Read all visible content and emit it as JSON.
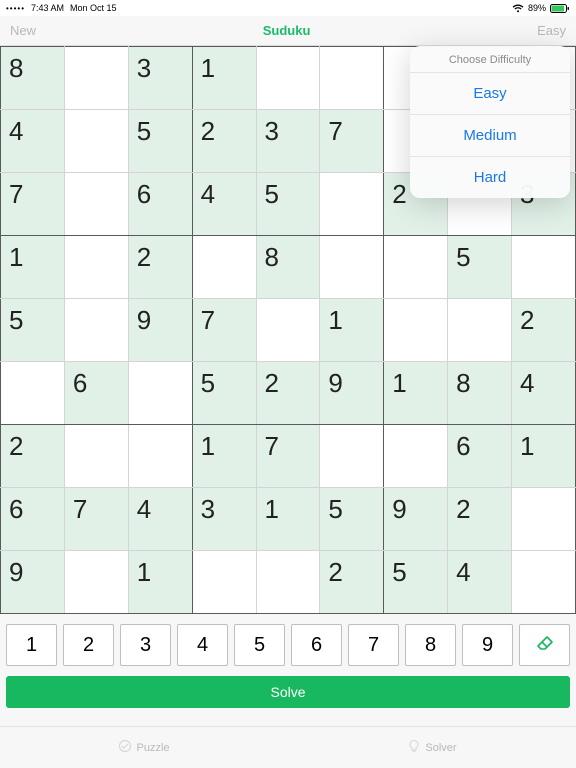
{
  "status": {
    "time": "7:43 AM",
    "date": "Mon Oct 15",
    "battery": "89%"
  },
  "nav": {
    "left": "New",
    "title": "Suduku",
    "right": "Easy"
  },
  "popover": {
    "header": "Choose Difficulty",
    "items": [
      "Easy",
      "Medium",
      "Hard"
    ]
  },
  "board": [
    [
      "8",
      "",
      "",
      "3",
      "",
      "1",
      "",
      "",
      "",
      ""
    ],
    [
      "4",
      "",
      "",
      "5",
      "",
      "2",
      "",
      "3",
      "",
      "7"
    ],
    [
      "7",
      "",
      "",
      "6",
      "",
      "4",
      "",
      "5",
      "",
      ""
    ],
    [
      "1",
      "",
      "",
      "2",
      "",
      "",
      "",
      "8",
      "",
      ""
    ],
    [
      "5",
      "",
      "",
      "9",
      "",
      "7",
      "",
      "",
      "",
      "1"
    ],
    [
      "",
      "",
      "6",
      "",
      "",
      "5",
      "",
      "2",
      "",
      "9"
    ],
    [
      "2",
      "",
      "",
      "",
      "",
      "1",
      "",
      "7",
      "",
      ""
    ],
    [
      "6",
      "",
      "7",
      "4",
      "",
      "3",
      "",
      "1",
      "",
      "5"
    ],
    [
      "9",
      "",
      "",
      "1",
      "",
      "",
      "",
      "",
      "",
      "2"
    ]
  ],
  "grid": [
    {
      "cells": [
        {
          "v": "8",
          "g": true
        },
        {
          "v": "",
          "g": false
        },
        {
          "v": "3",
          "g": true
        },
        {
          "v": "1",
          "g": true
        },
        {
          "v": "",
          "g": false
        },
        {
          "v": "",
          "g": false
        },
        {
          "v": "",
          "g": false
        },
        {
          "v": "",
          "g": false
        },
        {
          "v": "",
          "g": false
        }
      ]
    },
    {
      "cells": [
        {
          "v": "4",
          "g": true
        },
        {
          "v": "",
          "g": false
        },
        {
          "v": "5",
          "g": true
        },
        {
          "v": "2",
          "g": true
        },
        {
          "v": "3",
          "g": true
        },
        {
          "v": "7",
          "g": true
        },
        {
          "v": "",
          "g": false
        },
        {
          "v": "",
          "g": false
        },
        {
          "v": "",
          "g": false
        }
      ]
    },
    {
      "cells": [
        {
          "v": "7",
          "g": true
        },
        {
          "v": "",
          "g": false
        },
        {
          "v": "6",
          "g": true
        },
        {
          "v": "4",
          "g": true
        },
        {
          "v": "5",
          "g": true
        },
        {
          "v": "",
          "g": false
        },
        {
          "v": "2",
          "g": true
        },
        {
          "v": "",
          "g": false
        },
        {
          "v": "3",
          "g": true
        }
      ]
    },
    {
      "cells": [
        {
          "v": "1",
          "g": true
        },
        {
          "v": "",
          "g": false
        },
        {
          "v": "2",
          "g": true
        },
        {
          "v": "",
          "g": false
        },
        {
          "v": "8",
          "g": true
        },
        {
          "v": "",
          "g": false
        },
        {
          "v": "",
          "g": false
        },
        {
          "v": "5",
          "g": true
        },
        {
          "v": "",
          "g": false
        }
      ]
    },
    {
      "cells": [
        {
          "v": "5",
          "g": true
        },
        {
          "v": "",
          "g": false
        },
        {
          "v": "9",
          "g": true
        },
        {
          "v": "7",
          "g": true
        },
        {
          "v": "",
          "g": false
        },
        {
          "v": "1",
          "g": true
        },
        {
          "v": "",
          "g": false
        },
        {
          "v": "",
          "g": false
        },
        {
          "v": "2",
          "g": true
        }
      ]
    },
    {
      "cells": [
        {
          "v": "",
          "g": false
        },
        {
          "v": "6",
          "g": true
        },
        {
          "v": "",
          "g": false
        },
        {
          "v": "5",
          "g": true
        },
        {
          "v": "2",
          "g": true
        },
        {
          "v": "9",
          "g": true
        },
        {
          "v": "1",
          "g": true
        },
        {
          "v": "8",
          "g": true
        },
        {
          "v": "4",
          "g": true
        }
      ]
    },
    {
      "cells": [
        {
          "v": "2",
          "g": true
        },
        {
          "v": "",
          "g": false
        },
        {
          "v": "",
          "g": false
        },
        {
          "v": "1",
          "g": true
        },
        {
          "v": "7",
          "g": true
        },
        {
          "v": "",
          "g": false
        },
        {
          "v": "",
          "g": false
        },
        {
          "v": "6",
          "g": true
        },
        {
          "v": "1",
          "g": true
        }
      ]
    },
    {
      "cells": [
        {
          "v": "6",
          "g": true
        },
        {
          "v": "7",
          "g": true
        },
        {
          "v": "4",
          "g": true
        },
        {
          "v": "3",
          "g": true
        },
        {
          "v": "1",
          "g": true
        },
        {
          "v": "5",
          "g": true
        },
        {
          "v": "9",
          "g": true
        },
        {
          "v": "2",
          "g": true
        },
        {
          "v": "",
          "g": false
        }
      ]
    },
    {
      "cells": [
        {
          "v": "9",
          "g": true
        },
        {
          "v": "",
          "g": false
        },
        {
          "v": "1",
          "g": true
        },
        {
          "v": "",
          "g": false
        },
        {
          "v": "",
          "g": false
        },
        {
          "v": "2",
          "g": true
        },
        {
          "v": "5",
          "g": true
        },
        {
          "v": "4",
          "g": true
        },
        {
          "v": "",
          "g": false
        }
      ]
    }
  ],
  "numpad": [
    "1",
    "2",
    "3",
    "4",
    "5",
    "6",
    "7",
    "8",
    "9"
  ],
  "solve_label": "Solve",
  "tabs": {
    "puzzle": "Puzzle",
    "solver": "Solver"
  }
}
